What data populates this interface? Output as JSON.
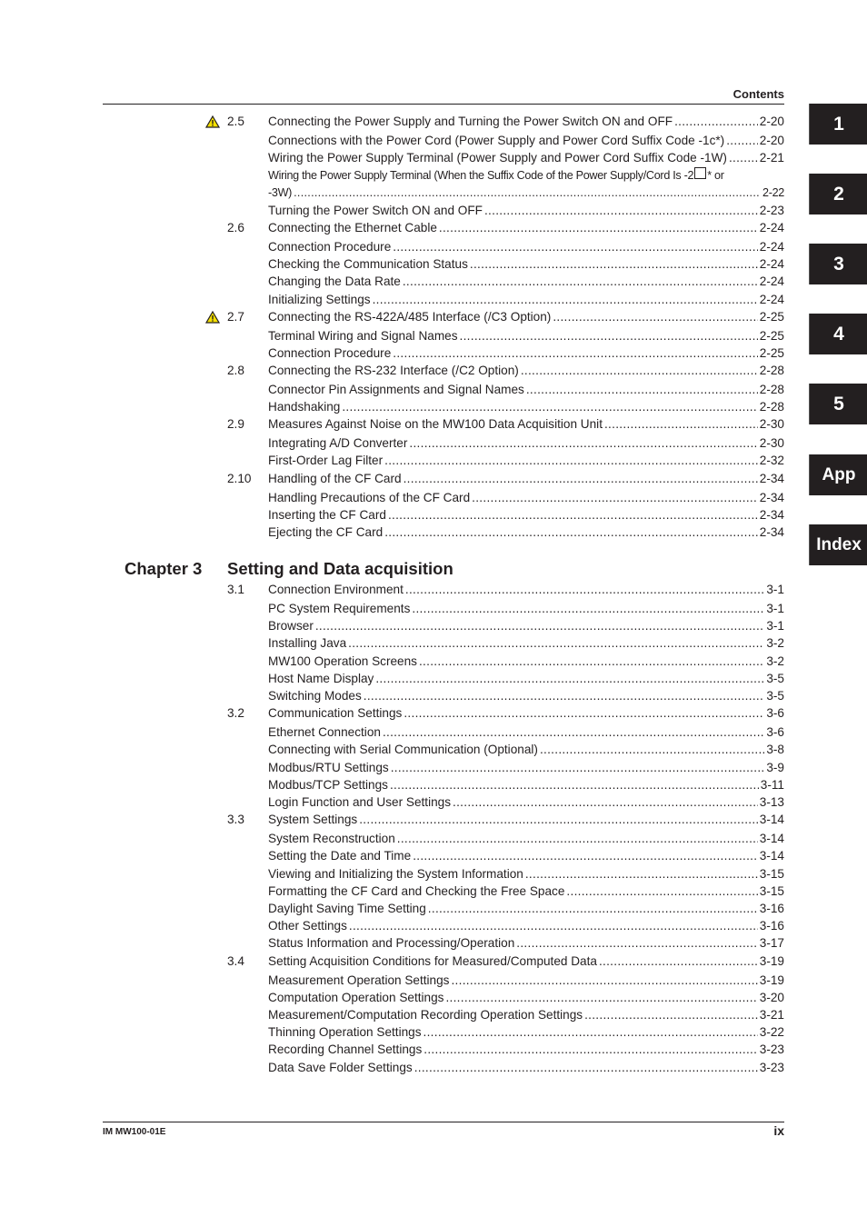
{
  "header": {
    "title": "Contents"
  },
  "footer": {
    "doc_id": "IM MW100-01E",
    "page_number": "ix"
  },
  "tabs": [
    "1",
    "2",
    "3",
    "4",
    "5",
    "App",
    "Index"
  ],
  "chapter3": {
    "label": "Chapter 3",
    "title": "Setting and Data acquisition"
  },
  "entries": [
    {
      "num": "2.5",
      "warn": true,
      "title": "Connecting the Power Supply and Turning the Power Switch ON and OFF",
      "page": "2-20"
    },
    {
      "title": "Connections with the Power Cord (Power Supply and Power Cord Suffix Code -1c*)",
      "page": "2-20"
    },
    {
      "title": "Wiring the Power Supply Terminal (Power Supply and Power Cord Suffix Code -1W)",
      "page": "2-21"
    },
    {
      "title_a": "Wiring the Power Supply Terminal (When the Suffix Code of the Power Supply/Cord Is -2",
      "title_b": "* or",
      "title_cont": "-3W)",
      "page": "2-22"
    },
    {
      "title": "Turning the Power Switch ON and OFF",
      "page": "2-23"
    },
    {
      "num": "2.6",
      "title": "Connecting the Ethernet Cable",
      "page": "2-24"
    },
    {
      "title": "Connection Procedure",
      "page": "2-24"
    },
    {
      "title": "Checking the Communication Status",
      "page": "2-24"
    },
    {
      "title": "Changing the Data Rate",
      "page": "2-24"
    },
    {
      "title": "Initializing Settings",
      "page": "2-24"
    },
    {
      "num": "2.7",
      "warn": true,
      "title": "Connecting the RS-422A/485 Interface (/C3 Option)",
      "page": "2-25"
    },
    {
      "title": "Terminal Wiring and Signal Names",
      "page": "2-25"
    },
    {
      "title": "Connection Procedure",
      "page": "2-25"
    },
    {
      "num": "2.8",
      "title": "Connecting the RS-232 Interface (/C2 Option)",
      "page": "2-28"
    },
    {
      "title": "Connector Pin Assignments and Signal Names",
      "page": "2-28"
    },
    {
      "title": "Handshaking",
      "page": "2-28"
    },
    {
      "num": "2.9",
      "title": "Measures Against Noise on the MW100 Data Acquisition Unit",
      "page": "2-30"
    },
    {
      "title": "Integrating A/D Converter",
      "page": "2-30"
    },
    {
      "title": "First-Order Lag Filter",
      "page": "2-32"
    },
    {
      "num": "2.10",
      "title": "Handling of the CF Card",
      "page": "2-34"
    },
    {
      "title": "Handling Precautions of the CF Card",
      "page": "2-34"
    },
    {
      "title": "Inserting the CF Card",
      "page": "2-34"
    },
    {
      "title": "Ejecting the CF Card",
      "page": "2-34"
    },
    {
      "num": "3.1",
      "title": "Connection Environment",
      "page": "3-1"
    },
    {
      "title": "PC System Requirements",
      "page": "3-1"
    },
    {
      "title": "Browser",
      "page": "3-1"
    },
    {
      "title": "Installing Java",
      "page": "3-2"
    },
    {
      "title": "MW100 Operation Screens",
      "page": "3-2"
    },
    {
      "title": "Host Name Display",
      "page": "3-5"
    },
    {
      "title": "Switching Modes",
      "page": "3-5"
    },
    {
      "num": "3.2",
      "title": "Communication Settings",
      "page": "3-6"
    },
    {
      "title": "Ethernet Connection",
      "page": "3-6"
    },
    {
      "title": "Connecting with Serial Communication (Optional)",
      "page": "3-8"
    },
    {
      "title": "Modbus/RTU Settings",
      "page": "3-9"
    },
    {
      "title": "Modbus/TCP Settings",
      "page": "3-11"
    },
    {
      "title": "Login Function and User Settings",
      "page": "3-13"
    },
    {
      "num": "3.3",
      "title": "System Settings",
      "page": "3-14"
    },
    {
      "title": "System Reconstruction",
      "page": "3-14"
    },
    {
      "title": "Setting the Date and Time",
      "page": "3-14"
    },
    {
      "title": "Viewing and Initializing the System Information",
      "page": "3-15"
    },
    {
      "title": "Formatting the CF Card and Checking the Free Space",
      "page": "3-15"
    },
    {
      "title": "Daylight Saving Time Setting",
      "page": "3-16"
    },
    {
      "title": "Other Settings",
      "page": "3-16"
    },
    {
      "title": "Status Information and Processing/Operation",
      "page": "3-17"
    },
    {
      "num": "3.4",
      "title": "Setting Acquisition Conditions for Measured/Computed Data",
      "page": "3-19"
    },
    {
      "title": "Measurement Operation Settings",
      "page": "3-19"
    },
    {
      "title": "Computation Operation Settings",
      "page": "3-20"
    },
    {
      "title": "Measurement/Computation Recording Operation Settings",
      "page": "3-21"
    },
    {
      "title": "Thinning Operation Settings",
      "page": "3-22"
    },
    {
      "title": "Recording Channel Settings",
      "page": "3-23"
    },
    {
      "title": "Data Save Folder Settings",
      "page": "3-23"
    }
  ]
}
